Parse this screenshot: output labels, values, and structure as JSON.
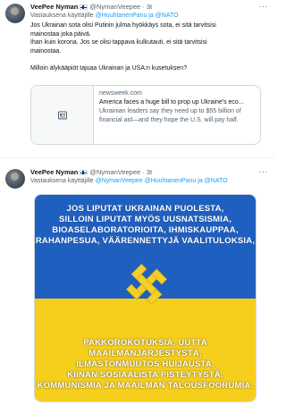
{
  "tweets": [
    {
      "author": "VeePee Nyman",
      "handle": "@NymanVeepee",
      "separator": "·",
      "time": "3t",
      "reply_prefix": "Vastauksena käyttäjille",
      "reply_mentions": "@HuuhtanenPanu ja @NATO",
      "lines": [
        "Jos Ukrainan sota olisi Putinin julma hyökkäys sota, ei sitä tarvitsisi",
        "mainostaa joka päivä.",
        "Ihan kuin korona. Jos se olisi tappava kulkutauti, ei sitä tarvitsisi",
        "mainostaa.",
        "",
        "Milloin älykääpiöt tajuaa Ukrainan ja USA:n kusetuksen?"
      ],
      "card": {
        "domain": "newsweek.com",
        "title": "America faces a huge bill to prop up Ukraine's eco...",
        "description": "Ukrainian leaders say they need up to $55 billion of financial aid—and they hope the U.S. will pay half."
      }
    },
    {
      "author": "VeePee Nyman",
      "handle": "@NymanVeepee",
      "separator": "·",
      "time": "3t",
      "reply_prefix": "Vastauksena käyttäjille",
      "reply_mentions": "@NymanVeepee @HuuhtanenPanu ja @NATO",
      "image": {
        "top_lines": [
          "JOS LIPUTAT UKRAINAN PUOLESTA,",
          "SILLOIN LIPUTAT MYÖS UUSNATSISMIA,",
          "BIOASELABORATORIOITA, IHMISKAUPPAA,",
          "RAHANPESUA, VÄÄRENNETTYJÄ VAALITULOKSIA,"
        ],
        "bottom_lines": [
          "PAKKOROKOTUKSIA, UUTTA MAAILMANJÄRJESTYSTÄ,",
          "ILMASTONMUUTOS HUIJAUSTA,",
          "KIINAN SOSIAALISTA PISTEYTYSTÄ,",
          "KOMMUNISMIA JA MAAILMAN TALOUSFOORUMIA."
        ],
        "top_color": "#1f5fbf",
        "bottom_color": "#f6cf1c",
        "emblem_color": "#f2cf2a"
      }
    }
  ],
  "icons": {
    "more": "more-dots-icon",
    "verified_flag": "finland-flag-icon",
    "card_placeholder": "article-icon"
  }
}
